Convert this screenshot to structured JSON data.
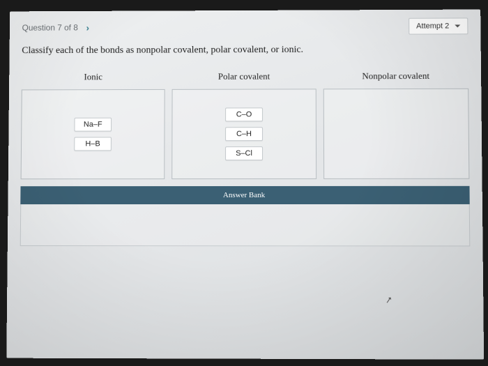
{
  "header": {
    "question_label": "Question 7 of 8",
    "attempt_label": "Attempt 2"
  },
  "prompt": "Classify each of the bonds as nonpolar covalent, polar covalent, or ionic.",
  "columns": [
    {
      "title": "Ionic",
      "items": [
        "Na–F",
        "H–B"
      ]
    },
    {
      "title": "Polar covalent",
      "items": [
        "C–O",
        "C–H",
        "S–Cl"
      ]
    },
    {
      "title": "Nonpolar covalent",
      "items": []
    }
  ],
  "bank": {
    "title": "Answer Bank",
    "items": []
  }
}
